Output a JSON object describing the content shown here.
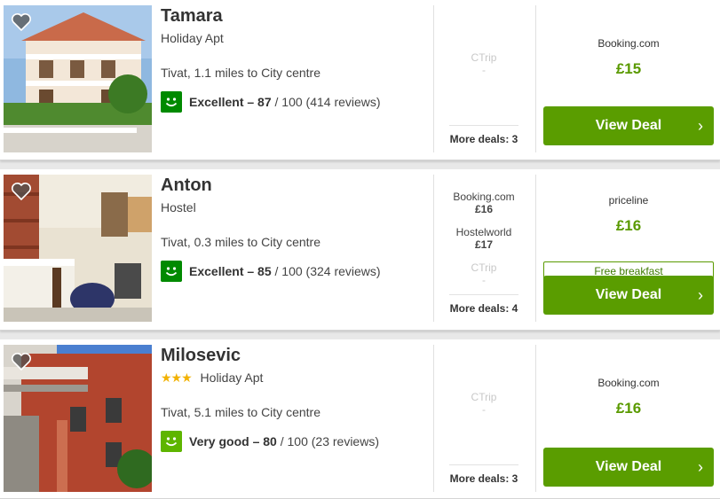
{
  "results": [
    {
      "name": "Tamara",
      "stars": "",
      "type": "Holiday Apt",
      "location": "Tivat, 1.1 miles to City centre",
      "rating_word": "Excellent – 87",
      "rating_rest": " / 100 (414 reviews)",
      "rating_level": "excellent",
      "other_deals": [
        {
          "provider": "CTrip",
          "price": "-",
          "dim": true
        }
      ],
      "more_deals": "More deals: 3",
      "main_provider": "Booking.com",
      "main_price": "£15",
      "extra_tag": "",
      "cta": "View Deal",
      "chevron": "›"
    },
    {
      "name": "Anton",
      "stars": "",
      "type": "Hostel",
      "location": "Tivat, 0.3 miles to City centre",
      "rating_word": "Excellent – 85",
      "rating_rest": " / 100 (324 reviews)",
      "rating_level": "excellent",
      "other_deals": [
        {
          "provider": "Booking.com",
          "price": "£16",
          "dim": false
        },
        {
          "provider": "Hostelworld",
          "price": "£17",
          "dim": false
        },
        {
          "provider": "CTrip",
          "price": "-",
          "dim": true
        }
      ],
      "more_deals": "More deals: 4",
      "main_provider": "priceline",
      "main_price": "£16",
      "extra_tag": "Free breakfast",
      "cta": "View Deal",
      "chevron": "›"
    },
    {
      "name": "Milosevic",
      "stars": "★★★",
      "type": "Holiday Apt",
      "location": "Tivat, 5.1 miles to City centre",
      "rating_word": "Very good – 80",
      "rating_rest": " / 100 (23 reviews)",
      "rating_level": "verygood",
      "other_deals": [
        {
          "provider": "CTrip",
          "price": "-",
          "dim": true
        }
      ],
      "more_deals": "More deals: 3",
      "main_provider": "Booking.com",
      "main_price": "£16",
      "extra_tag": "",
      "cta": "View Deal",
      "chevron": "›"
    }
  ],
  "colors": {
    "cta": "#5a9d00",
    "price": "#5a9a00",
    "excellent": "#008a00",
    "very_good": "#5eb500",
    "stars": "#f2b203"
  },
  "icons": [
    "heart-icon",
    "smiley-rating-icon",
    "chevron-right-icon"
  ]
}
